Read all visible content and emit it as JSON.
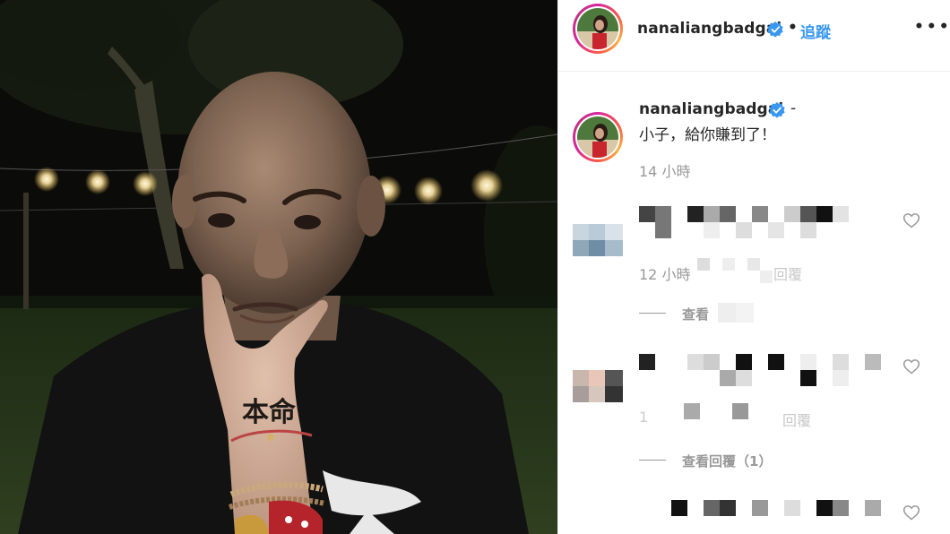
{
  "post": {
    "username": "nanaliangbadgal",
    "separator": "•",
    "follow_label": "追蹤",
    "more_label": "•••"
  },
  "caption": {
    "username": "nanaliangbadgal",
    "suffix": "-",
    "text": "小子，給你賺到了！",
    "timestamp": "14 小時"
  },
  "comments": [
    {
      "timestamp": "12 小時",
      "reply_label": "回覆",
      "view_replies_label": "查看"
    },
    {
      "timestamp": "1",
      "reply_label": "回覆",
      "view_replies_label": "查看回覆（1）"
    },
    {
      "timestamp": ""
    }
  ],
  "photo": {
    "tattoo_text": "本命"
  },
  "colors": {
    "link_blue": "#3897f0",
    "text": "#262626",
    "muted": "#999999",
    "verified_blue": "#3897f0"
  },
  "icons": {
    "verified": "verified-badge-icon",
    "heart": "heart-outline-icon",
    "more": "more-options-icon"
  }
}
